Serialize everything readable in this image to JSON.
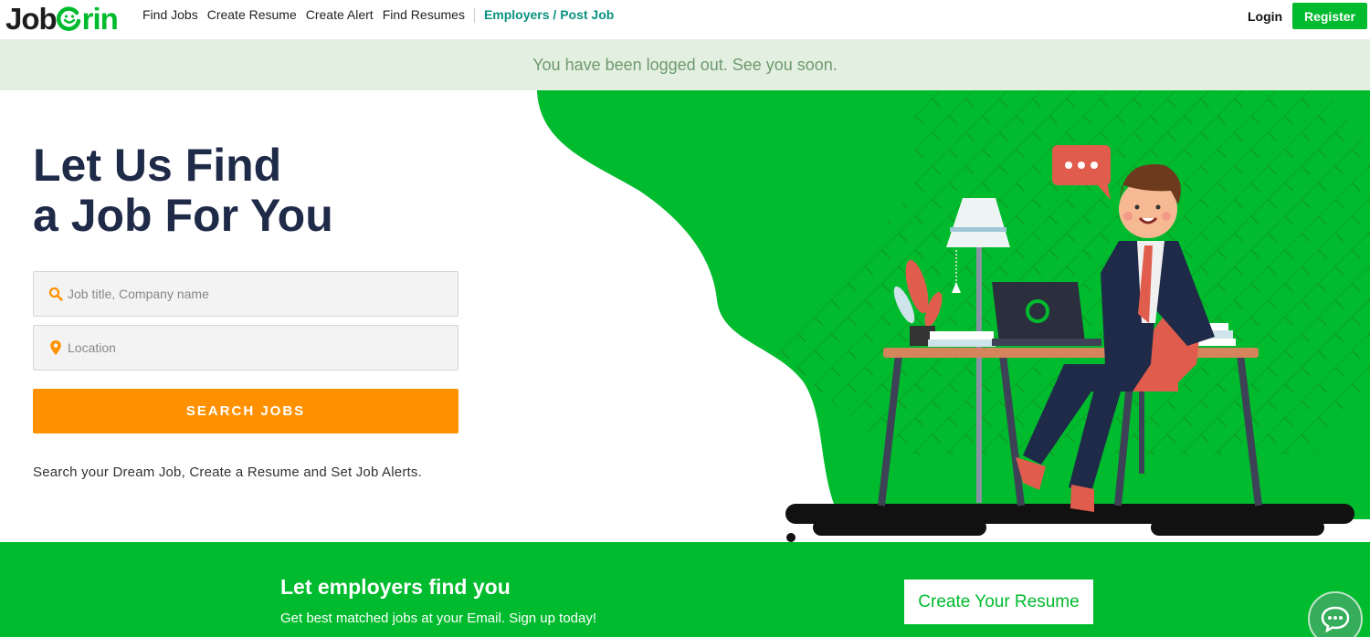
{
  "brand": {
    "logo_left": "Job",
    "logo_right": "rin"
  },
  "nav": {
    "links": [
      "Find Jobs",
      "Create Resume",
      "Create Alert",
      "Find Resumes"
    ],
    "employers": "Employers / Post Job",
    "login": "Login",
    "register": "Register"
  },
  "alert": {
    "message": "You have been logged out. See you soon."
  },
  "hero": {
    "headline_line1": "Let Us Find",
    "headline_line2": "a Job For You",
    "search": {
      "keyword_placeholder": "Job title, Company name",
      "location_placeholder": "Location",
      "button": "SEARCH JOBS"
    },
    "tagline": "Search your Dream Job, Create a Resume and Set Job Alerts."
  },
  "cta": {
    "title": "Let employers find you",
    "subtitle": "Get best matched jobs at your Email. Sign up today!",
    "button": "Create Your Resume"
  },
  "colors": {
    "brand_green": "#00bb2d",
    "orange": "#ff9100",
    "navy": "#1f2a48",
    "alert_bg": "#e3efe0"
  },
  "icons": [
    "search-icon",
    "location-pin-icon",
    "chat-icon"
  ]
}
